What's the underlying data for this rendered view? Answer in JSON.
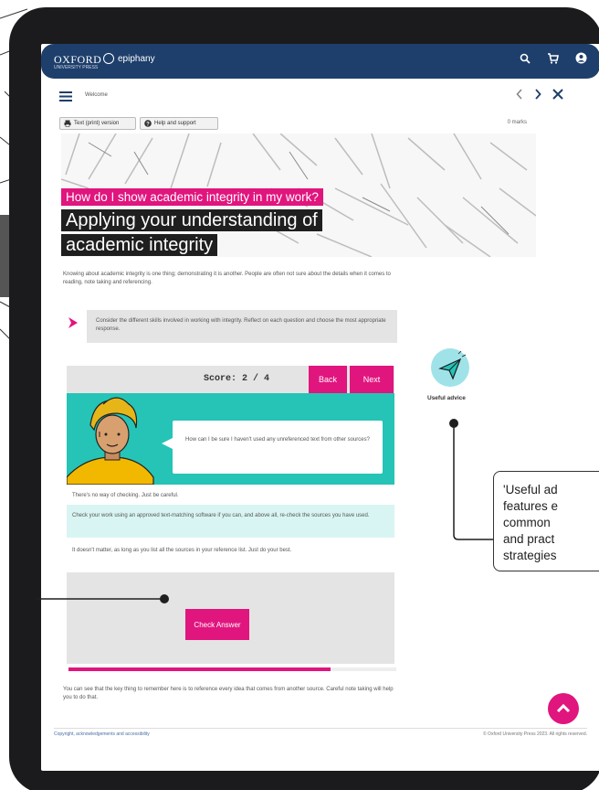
{
  "topbar": {
    "brand": "OXFORD",
    "brand_sub": "UNIVERSITY PRESS",
    "product": "epiphany"
  },
  "nav": {
    "section": "Welcome"
  },
  "tools": {
    "text_version": "Text (print) version",
    "help": "Help and support",
    "marks": "0 marks"
  },
  "hero": {
    "question": "How do I show academic integrity in my work?",
    "title_line1": "Applying your understanding of",
    "title_line2": "academic integrity"
  },
  "intro_text": "Knowing about academic integrity is one thing; demonstrating it is another. People are often not sure about the details when it comes to reading, note taking and referencing.",
  "instruction": "Consider the different skills involved in working with integrity. Reflect on each question and choose the most appropriate response.",
  "quiz": {
    "score_label": "Score:",
    "score_value": "2 / 4",
    "score_fraction": 0.5,
    "back_label": "Back",
    "next_label": "Next",
    "question": "How can I be sure I haven't used any unreferenced text from other sources?",
    "options": [
      "There's no way of checking. Just be careful.",
      "Check your work using an approved text-matching software if you can, and above all, re-check the sources you have used.",
      "It doesn't matter, as long as you list all the sources in your reference list. Just do your best."
    ],
    "check_label": "Check Answer",
    "progress": 0.8
  },
  "conclusion": "You can see that the key thing to remember here is to reference every idea that comes from another source. Careful note taking will help you to do that.",
  "footer": {
    "left": "Copyright, acknowledgements and accessibility",
    "right": "© Oxford University Press 2023. All rights reserved."
  },
  "sidebar": {
    "advice_label": "Useful advice"
  },
  "callout": {
    "text_lines": [
      "'Useful ad",
      "features e",
      "common",
      "and pract",
      "strategies"
    ]
  },
  "colors": {
    "brand_navy": "#1e3f6b",
    "accent_magenta": "#e1157e",
    "teal": "#25c4b6",
    "device_frame": "#1b1b1d"
  }
}
